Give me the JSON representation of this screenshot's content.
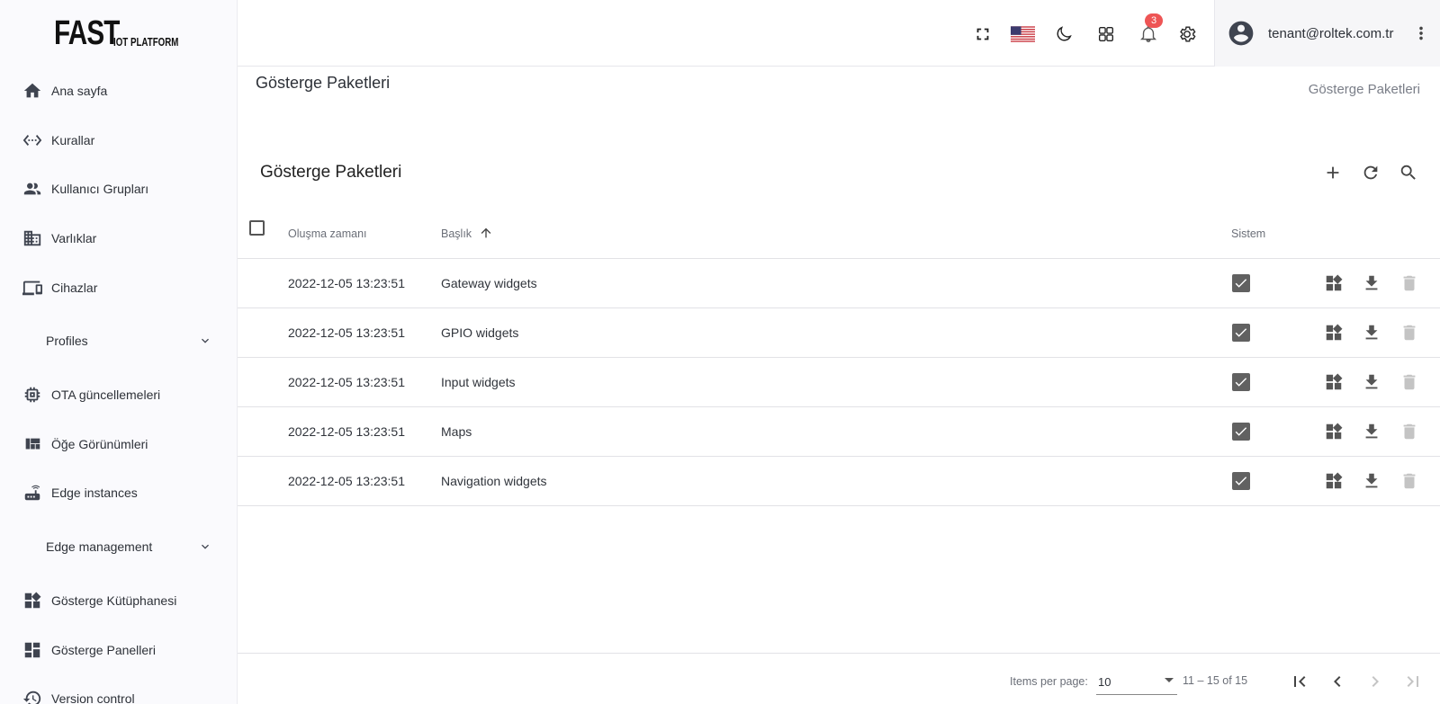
{
  "logo": {
    "big": "FAST",
    "small": "IOT PLATFORM"
  },
  "sidebar": {
    "items": [
      {
        "label": "Ana sayfa",
        "icon": "home-icon"
      },
      {
        "label": "Kurallar",
        "icon": "rule-chain-icon"
      },
      {
        "label": "Kullanıcı Grupları",
        "icon": "user-group-icon"
      },
      {
        "label": "Varlıklar",
        "icon": "domain-icon"
      },
      {
        "label": "Cihazlar",
        "icon": "devices-icon"
      },
      {
        "label": "Profiles",
        "icon": "chevron-down-icon",
        "group": true
      },
      {
        "label": "OTA güncellemeleri",
        "icon": "memory-chip-icon"
      },
      {
        "label": "Öğe Görünümleri",
        "icon": "view-quilt-icon"
      },
      {
        "label": "Edge instances",
        "icon": "router-icon"
      },
      {
        "label": "Edge management",
        "icon": "chevron-down-icon",
        "group": true
      },
      {
        "label": "Gösterge Kütüphanesi",
        "icon": "widgets-icon"
      },
      {
        "label": "Gösterge Panelleri",
        "icon": "dashboard-icon"
      },
      {
        "label": "Version control",
        "icon": "history-icon"
      }
    ]
  },
  "topbar": {
    "notification_count": "3",
    "user_email": "tenant@roltek.com.tr",
    "icons": [
      "fullscreen-icon",
      "us-flag-icon",
      "dark-mode-icon",
      "apps-icon",
      "bell-icon",
      "gear-icon",
      "account-circle-icon",
      "more-vert-icon"
    ]
  },
  "page": {
    "title": "Gösterge Paketleri",
    "breadcrumb": "Gösterge Paketleri"
  },
  "card": {
    "title": "Gösterge Paketleri",
    "actions": [
      "add-icon",
      "refresh-icon",
      "search-icon"
    ]
  },
  "table": {
    "columns": {
      "created": "Oluşma zamanı",
      "title": "Başlık",
      "system": "Sistem"
    },
    "sort": {
      "column": "title",
      "direction": "asc"
    },
    "rows": [
      {
        "created": "2022-12-05 13:23:51",
        "title": "Gateway widgets",
        "system": true
      },
      {
        "created": "2022-12-05 13:23:51",
        "title": "GPIO widgets",
        "system": true
      },
      {
        "created": "2022-12-05 13:23:51",
        "title": "Input widgets",
        "system": true
      },
      {
        "created": "2022-12-05 13:23:51",
        "title": "Maps",
        "system": true
      },
      {
        "created": "2022-12-05 13:23:51",
        "title": "Navigation widgets",
        "system": true
      }
    ]
  },
  "pagination": {
    "items_per_page_label": "Items per page:",
    "page_size": "10",
    "range": "11 – 15 of 15"
  },
  "colors": {
    "badge": "#ee5555",
    "checkbox_fill": "#616161",
    "sidebar_bg": "#fafafd"
  }
}
